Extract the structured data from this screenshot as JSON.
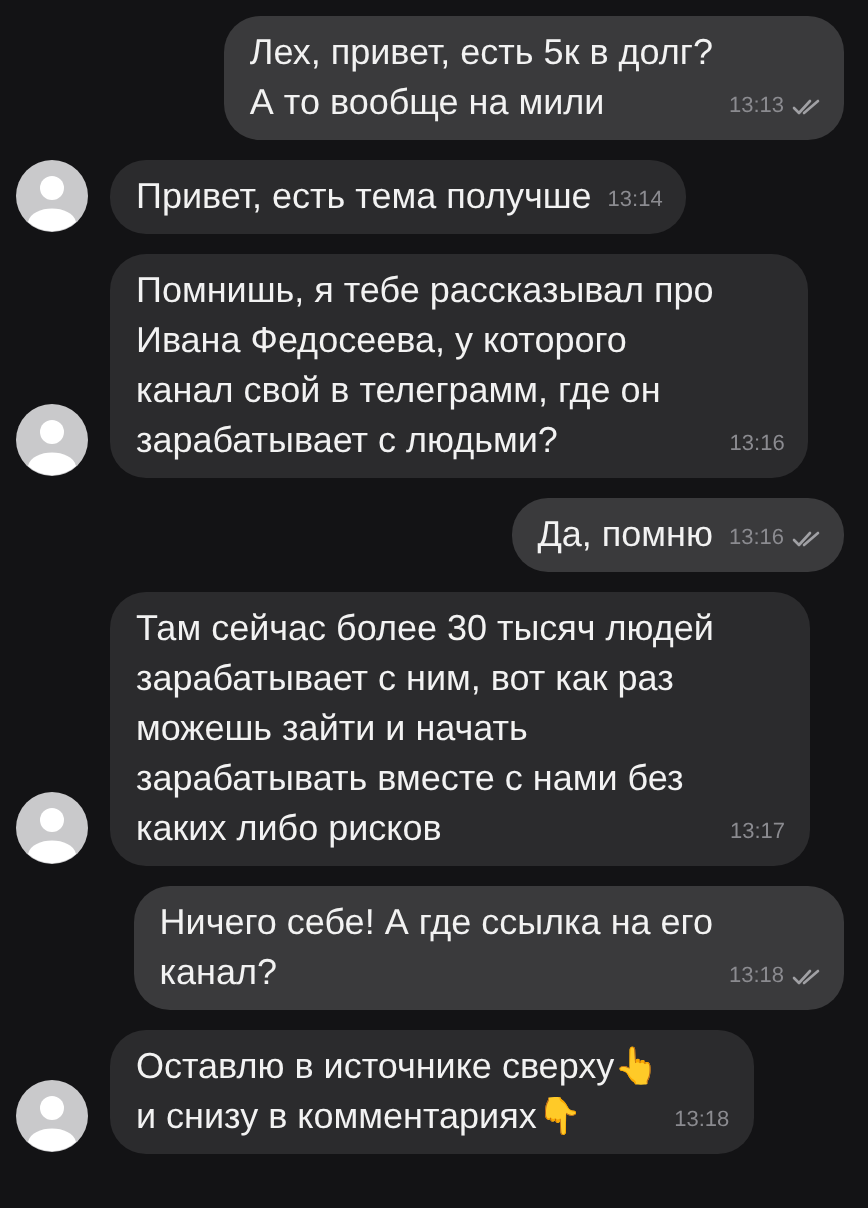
{
  "messages": [
    {
      "kind": "outgoing",
      "text": "Лех, привет, есть 5к в долг?\nА то вообще на мили",
      "time": "13:13",
      "read": true
    },
    {
      "kind": "incoming",
      "text": "Привет, есть тема получше",
      "time": "13:14"
    },
    {
      "kind": "incoming",
      "text": "Помнишь, я тебе рассказывал про\nИвана Федосеева, у которого\nканал свой в телеграмм, где он\nзарабатывает с людьми?",
      "time": "13:16"
    },
    {
      "kind": "outgoing",
      "text": "Да, помню",
      "time": "13:16",
      "read": true
    },
    {
      "kind": "incoming",
      "text": "Там сейчас более 30 тысяч людей\nзарабатывает с ним, вот как раз\nможешь зайти и начать\nзарабатывать вместе с нами без\nкаких либо рисков",
      "time": "13:17"
    },
    {
      "kind": "outgoing",
      "text": "Ничего себе! А где ссылка на его\nканал?",
      "time": "13:18",
      "read": true
    },
    {
      "kind": "incoming",
      "text": "Оставлю в источнике сверху👆\nи снизу в комментариях👇",
      "time": "13:18"
    }
  ]
}
